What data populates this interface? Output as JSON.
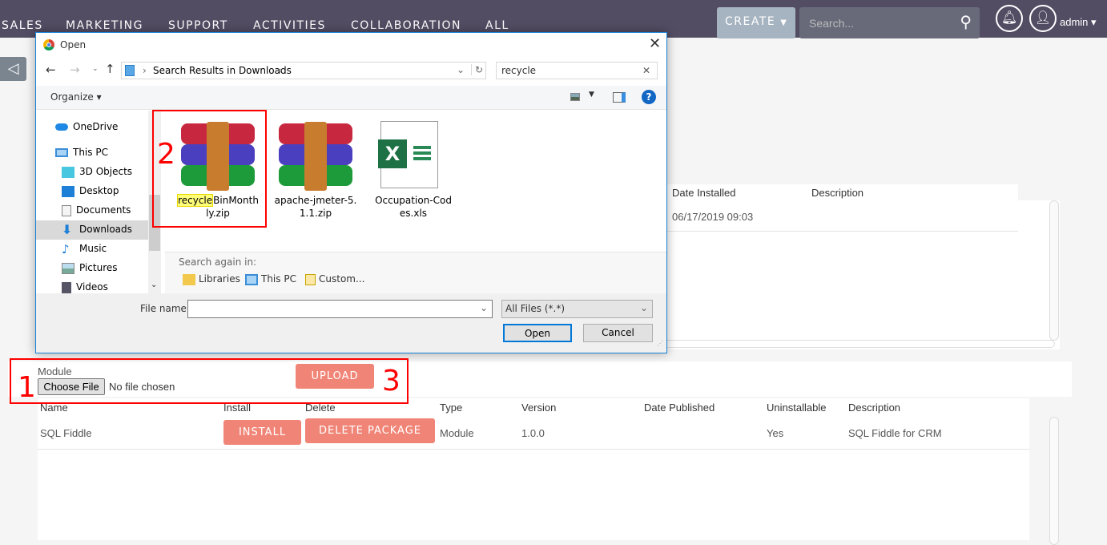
{
  "topnav": {
    "items": [
      "SALES",
      "MARKETING",
      "SUPPORT",
      "ACTIVITIES",
      "COLLABORATION",
      "ALL"
    ],
    "create_label": "CREATE",
    "search_placeholder": "Search...",
    "user": "admin"
  },
  "colors": {
    "nav_bg": "#534d64",
    "button": "#f08577",
    "annotation": "#ff0000"
  },
  "upper_table": {
    "headers": [
      "Date Installed",
      "Description"
    ],
    "rows": [
      [
        "06/17/2019 09:03",
        ""
      ]
    ]
  },
  "upload": {
    "label": "Module",
    "choose_file": "Choose File",
    "no_file": "No file chosen",
    "upload_label": "UPLOAD"
  },
  "lower_table": {
    "headers": [
      "Name",
      "Install",
      "Delete",
      "Type",
      "Version",
      "Date Published",
      "Uninstallable",
      "Description"
    ],
    "rows": [
      {
        "name": "SQL Fiddle",
        "install": "INSTALL",
        "delete": "DELETE PACKAGE",
        "type": "Module",
        "version": "1.0.0",
        "date_published": "",
        "uninstallable": "Yes",
        "description": "SQL Fiddle for CRM"
      }
    ]
  },
  "dialog": {
    "title": "Open",
    "path": "Search Results in Downloads",
    "search_value": "recycle",
    "organize": "Organize",
    "nav": [
      "OneDrive",
      "This PC",
      "3D Objects",
      "Desktop",
      "Documents",
      "Downloads",
      "Music",
      "Pictures",
      "Videos"
    ],
    "files": [
      {
        "name_highlight": "recycle",
        "name_rest": "BinMonthly.zip",
        "line1": "BinMonth",
        "line2": "ly.zip"
      },
      {
        "line1": "apache-jmeter-5.",
        "line2": "1.1.zip"
      },
      {
        "line1": "Occupation-Cod",
        "line2": "es.xls"
      }
    ],
    "search_again": "Search again in:",
    "search_again_items": [
      "Libraries",
      "This PC",
      "Custom..."
    ],
    "file_name_label": "File name:",
    "file_name_value": "",
    "filter": "All Files (*.*)",
    "open": "Open",
    "cancel": "Cancel"
  },
  "annotations": [
    "1",
    "2",
    "3"
  ]
}
